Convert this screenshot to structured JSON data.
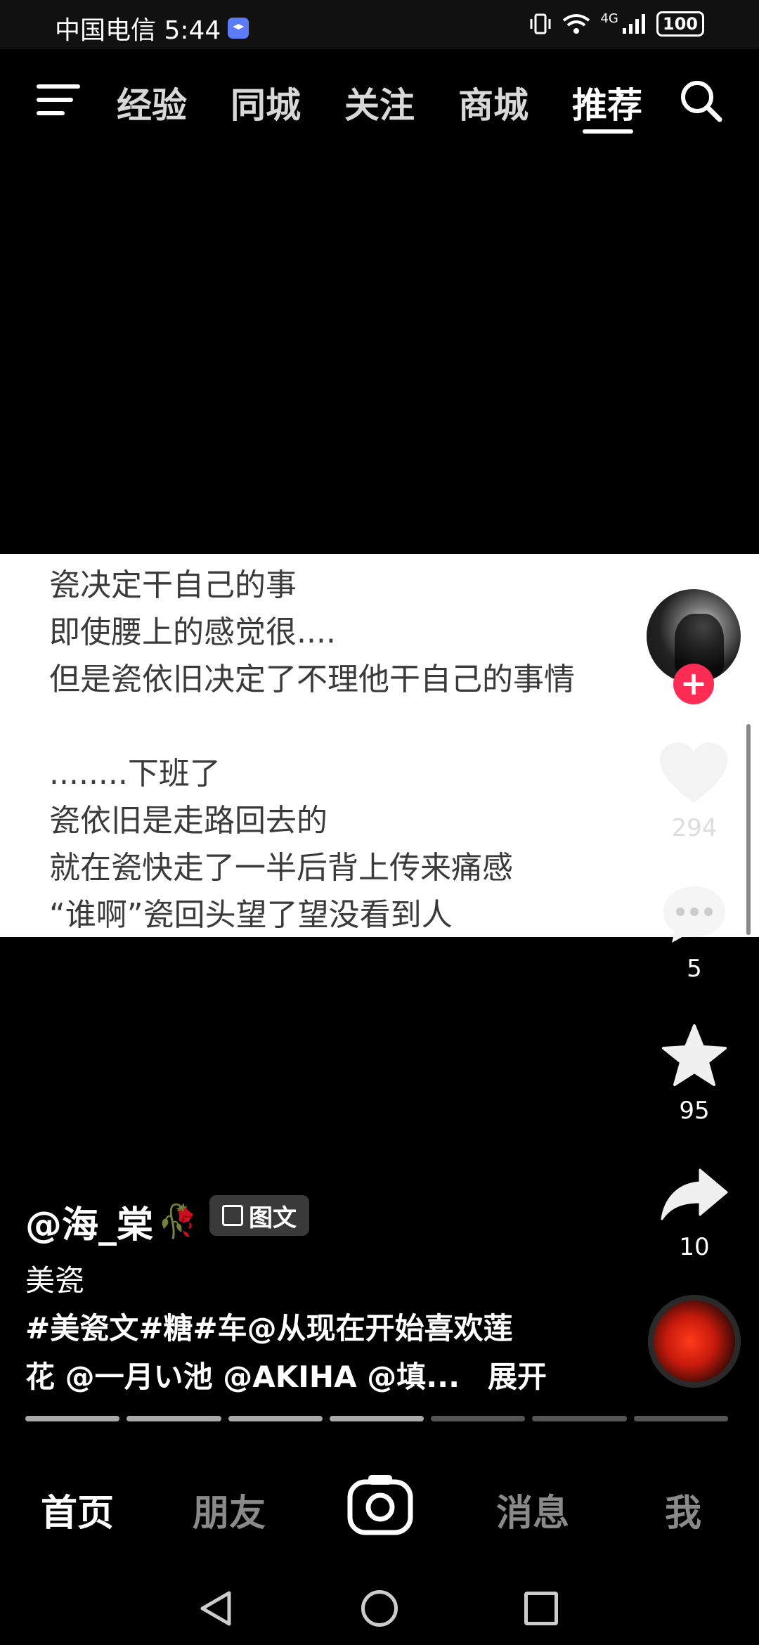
{
  "status_bar": {
    "carrier_time": "中国电信 5:44",
    "network": "4G",
    "battery": "100"
  },
  "top_tabs": [
    "经验",
    "同城",
    "关注",
    "商城",
    "推荐"
  ],
  "active_tab": "推荐",
  "content": {
    "lines": [
      "瓷决定干自己的事",
      "即使腰上的感觉很....",
      "但是瓷依旧决定了不理他干自己的事情",
      "",
      "........下班了",
      "瓷依旧是走路回去的",
      "就在瓷快走了一半后背上传来痛感",
      "“谁啊”瓷回头望了望没看到人"
    ]
  },
  "actions": {
    "follow": "+",
    "like_count": "294",
    "comment_count": "5",
    "favorite_count": "95",
    "share_count": "10"
  },
  "caption": {
    "author": "@海_棠",
    "badge": "图文",
    "subtitle": "美瓷",
    "desc_line1": "#美瓷文#糖#车@从现在开始喜欢莲",
    "desc_line2": "花 @一月い池 @AKIHA @填...",
    "expand": "展开"
  },
  "progress": {
    "total": 7,
    "completed": 4
  },
  "bottom_nav": {
    "home": "首页",
    "friends": "朋友",
    "messages": "消息",
    "me": "我"
  },
  "colors": {
    "accent": "#fe2c55",
    "background": "#000000",
    "card": "#ffffff"
  }
}
